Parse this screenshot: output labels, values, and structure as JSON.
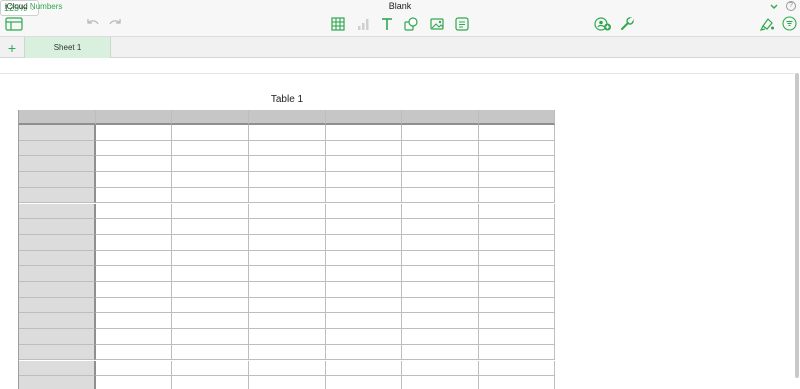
{
  "app": {
    "brand_icloud": "iCloud",
    "brand_numbers": "Numbers",
    "document_title": "Blank"
  },
  "toolbar": {
    "zoom_value": "125%",
    "icons": {
      "view": "sidebar-view-icon",
      "undo": "undo-icon",
      "redo": "redo-icon",
      "table": "table-icon",
      "chart": "chart-icon",
      "text": "text-icon",
      "shape": "shape-icon",
      "media": "media-icon",
      "comment": "comment-icon",
      "collaborate": "collaborate-icon",
      "settings": "wrench-icon",
      "format": "format-brush-icon",
      "organize": "organize-filter-icon",
      "help": "help-icon",
      "title_menu": "chevron-down-icon"
    },
    "help_glyph": "?"
  },
  "sheets": {
    "add_glyph": "+",
    "tabs": [
      {
        "label": "Sheet 1",
        "selected": true
      }
    ]
  },
  "table": {
    "title": "Table 1",
    "header_rows": 1,
    "header_columns": 1,
    "visible_columns": 7,
    "visible_body_rows": 17
  },
  "colors": {
    "accent_green": "#2fa84f",
    "sheet_tab_bg": "#d9f0df",
    "table_header_bg": "#c6c6c6",
    "header_column_bg": "#dcdcdc",
    "grid_line": "#bdbdbd"
  }
}
